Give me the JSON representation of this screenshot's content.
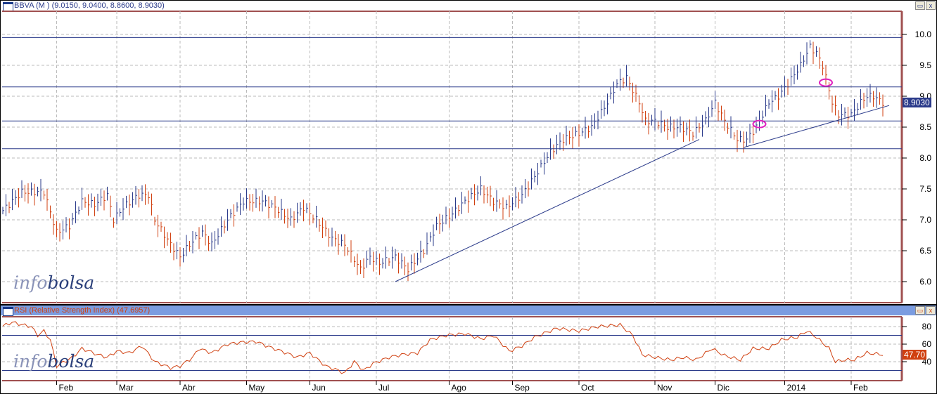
{
  "price_panel": {
    "title": "BBVA (M ) (9.0150, 9.0400, 8.8600, 8.9030)",
    "last_tag": "8.9030",
    "logo_a": "info",
    "logo_b": "bolsa"
  },
  "rsi_panel": {
    "title": "RSI (Relative Strength Index) (47.6957)",
    "last_tag": "47.70",
    "logo_a": "info",
    "logo_b": "bolsa"
  },
  "buttons": {
    "restore": "▭",
    "close": "x"
  },
  "colors": {
    "up": "#2a3a8a",
    "down": "#d04010",
    "line": "#2a3a8a",
    "rsi": "#d04010",
    "marker": "#e020c0",
    "axis": "#a05050"
  },
  "chart_data": [
    {
      "type": "bar",
      "title": "BBVA (M )",
      "ylim": [
        5.7,
        10.4
      ],
      "yticks": [
        "6.0",
        "6.5",
        "7.0",
        "7.5",
        "8.0",
        "8.5",
        "9.0",
        "9.5",
        "10.0"
      ],
      "x_months": [
        {
          "label": "Feb",
          "day": 17
        },
        {
          "label": "Mar",
          "day": 36
        },
        {
          "label": "Abr",
          "day": 56
        },
        {
          "label": "May",
          "day": 77
        },
        {
          "label": "Jun",
          "day": 97
        },
        {
          "label": "Jul",
          "day": 118
        },
        {
          "label": "Ago",
          "day": 141
        },
        {
          "label": "Sep",
          "day": 161
        },
        {
          "label": "Oct",
          "day": 182
        },
        {
          "label": "Nov",
          "day": 206
        },
        {
          "label": "Dic",
          "day": 225
        },
        {
          "label": "2014",
          "day": 247
        },
        {
          "label": "Feb",
          "day": 268
        }
      ],
      "closes": [
        [
          1,
          7.2
        ],
        [
          6,
          7.45
        ],
        [
          13,
          7.45
        ],
        [
          17,
          6.8
        ],
        [
          21,
          6.9
        ],
        [
          25,
          7.3
        ],
        [
          29,
          7.25
        ],
        [
          33,
          7.4
        ],
        [
          35,
          7.0
        ],
        [
          38,
          7.2
        ],
        [
          43,
          7.4
        ],
        [
          46,
          7.4
        ],
        [
          48,
          7.0
        ],
        [
          53,
          6.6
        ],
        [
          56,
          6.4
        ],
        [
          59,
          6.6
        ],
        [
          63,
          6.8
        ],
        [
          66,
          6.6
        ],
        [
          71,
          7.0
        ],
        [
          76,
          7.3
        ],
        [
          82,
          7.3
        ],
        [
          86,
          7.2
        ],
        [
          91,
          7.0
        ],
        [
          95,
          7.2
        ],
        [
          99,
          7.0
        ],
        [
          104,
          6.7
        ],
        [
          108,
          6.6
        ],
        [
          113,
          6.2
        ],
        [
          116,
          6.4
        ],
        [
          119,
          6.3
        ],
        [
          124,
          6.4
        ],
        [
          128,
          6.2
        ],
        [
          133,
          6.5
        ],
        [
          137,
          6.9
        ],
        [
          142,
          7.1
        ],
        [
          146,
          7.3
        ],
        [
          151,
          7.5
        ],
        [
          155,
          7.3
        ],
        [
          159,
          7.2
        ],
        [
          164,
          7.4
        ],
        [
          168,
          7.7
        ],
        [
          173,
          8.1
        ],
        [
          177,
          8.3
        ],
        [
          182,
          8.4
        ],
        [
          186,
          8.5
        ],
        [
          191,
          8.9
        ],
        [
          194,
          9.2
        ],
        [
          197,
          9.3
        ],
        [
          201,
          8.9
        ],
        [
          203,
          8.6
        ],
        [
          206,
          8.6
        ],
        [
          210,
          8.5
        ],
        [
          214,
          8.5
        ],
        [
          218,
          8.4
        ],
        [
          222,
          8.6
        ],
        [
          225,
          8.9
        ],
        [
          228,
          8.6
        ],
        [
          232,
          8.3
        ],
        [
          235,
          8.3
        ],
        [
          238,
          8.5
        ],
        [
          242,
          8.9
        ],
        [
          245,
          9.0
        ],
        [
          248,
          9.2
        ],
        [
          252,
          9.5
        ],
        [
          255,
          9.8
        ],
        [
          257,
          9.7
        ],
        [
          259,
          9.5
        ],
        [
          262,
          8.9
        ],
        [
          264,
          8.7
        ],
        [
          266,
          8.7
        ],
        [
          268,
          8.7
        ],
        [
          271,
          8.9
        ],
        [
          273,
          9.0
        ],
        [
          275,
          9.0
        ],
        [
          278,
          8.9
        ]
      ],
      "hlines": [
        9.95,
        9.15,
        8.6,
        8.15
      ],
      "trendlines": [
        [
          [
            124,
            6.0
          ],
          [
            220,
            8.3
          ]
        ],
        [
          [
            234,
            8.17
          ],
          [
            280,
            8.85
          ]
        ]
      ],
      "markers": [
        [
          239,
          8.55
        ],
        [
          260,
          9.22
        ]
      ]
    },
    {
      "type": "line",
      "title": "RSI (Relative Strength Index)",
      "ylim": [
        17,
        90
      ],
      "yticks": [
        "40",
        "60",
        "80"
      ],
      "hlines": [
        70,
        30
      ],
      "values": [
        [
          1,
          82
        ],
        [
          3,
          85
        ],
        [
          5,
          83
        ],
        [
          9,
          80
        ],
        [
          11,
          70
        ],
        [
          13,
          75
        ],
        [
          15,
          65
        ],
        [
          17,
          35
        ],
        [
          22,
          45
        ],
        [
          25,
          55
        ],
        [
          30,
          48
        ],
        [
          33,
          45
        ],
        [
          36,
          52
        ],
        [
          40,
          50
        ],
        [
          44,
          58
        ],
        [
          48,
          40
        ],
        [
          53,
          33
        ],
        [
          56,
          35
        ],
        [
          60,
          45
        ],
        [
          62,
          55
        ],
        [
          66,
          50
        ],
        [
          71,
          60
        ],
        [
          75,
          62
        ],
        [
          80,
          63
        ],
        [
          84,
          57
        ],
        [
          88,
          52
        ],
        [
          93,
          45
        ],
        [
          97,
          50
        ],
        [
          102,
          35
        ],
        [
          106,
          30
        ],
        [
          108,
          27
        ],
        [
          111,
          40
        ],
        [
          114,
          30
        ],
        [
          117,
          38
        ],
        [
          122,
          45
        ],
        [
          126,
          48
        ],
        [
          131,
          50
        ],
        [
          135,
          65
        ],
        [
          140,
          70
        ],
        [
          146,
          72
        ],
        [
          151,
          66
        ],
        [
          155,
          70
        ],
        [
          160,
          52
        ],
        [
          164,
          58
        ],
        [
          168,
          68
        ],
        [
          175,
          78
        ],
        [
          182,
          75
        ],
        [
          188,
          80
        ],
        [
          195,
          82
        ],
        [
          199,
          70
        ],
        [
          202,
          48
        ],
        [
          206,
          45
        ],
        [
          211,
          42
        ],
        [
          215,
          45
        ],
        [
          219,
          42
        ],
        [
          224,
          55
        ],
        [
          228,
          47
        ],
        [
          233,
          42
        ],
        [
          237,
          55
        ],
        [
          242,
          55
        ],
        [
          246,
          65
        ],
        [
          251,
          68
        ],
        [
          254,
          75
        ],
        [
          257,
          68
        ],
        [
          261,
          55
        ],
        [
          263,
          40
        ],
        [
          266,
          42
        ],
        [
          269,
          42
        ],
        [
          273,
          50
        ],
        [
          278,
          48
        ]
      ]
    }
  ]
}
